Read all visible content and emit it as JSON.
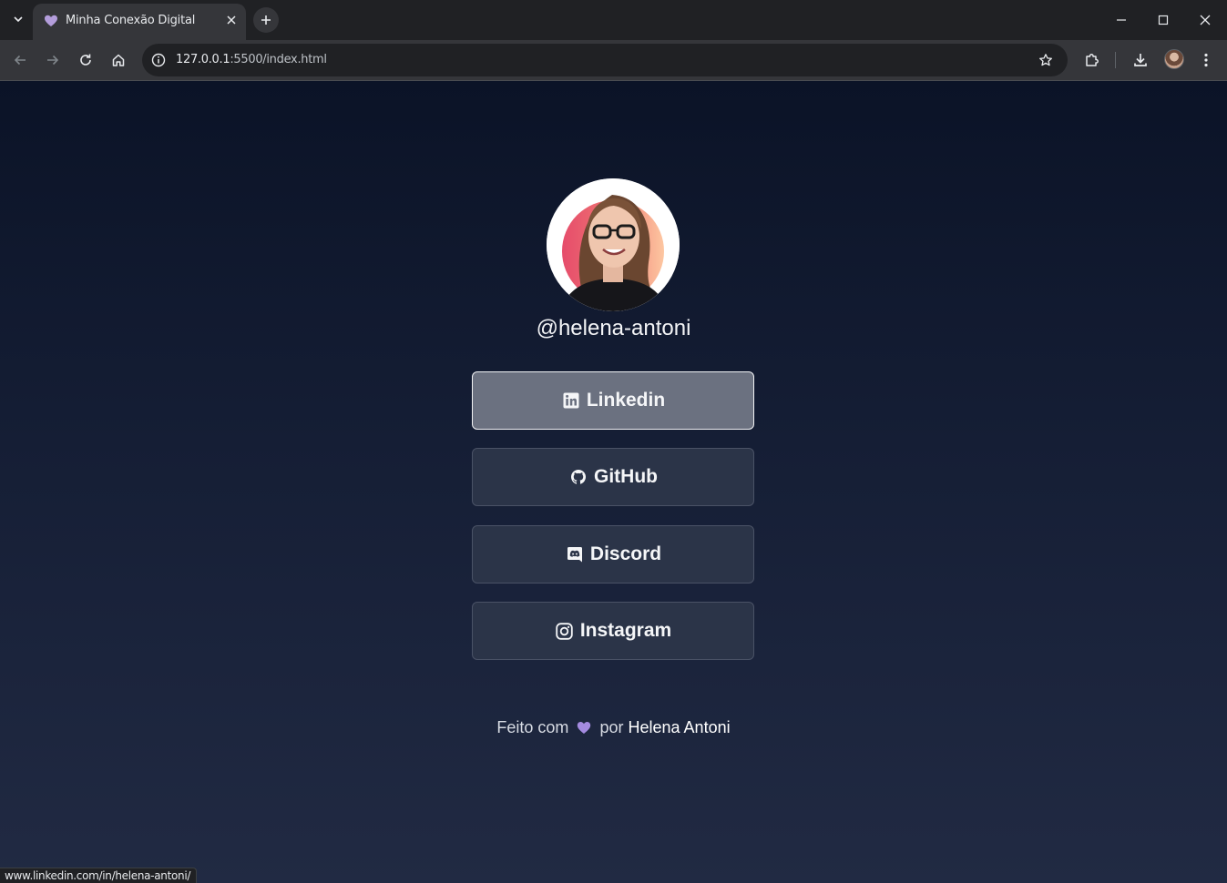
{
  "browser": {
    "tab_title": "Minha Conexão Digital",
    "url_host": "127.0.0.1",
    "url_rest": ":5500/index.html",
    "status_url": "www.linkedin.com/in/helena-antoni/"
  },
  "profile": {
    "handle": "@helena-antoni"
  },
  "links": [
    {
      "label": "Linkedin",
      "icon": "linkedin-icon"
    },
    {
      "label": "GitHub",
      "icon": "github-icon"
    },
    {
      "label": "Discord",
      "icon": "discord-icon"
    },
    {
      "label": "Instagram",
      "icon": "instagram-icon"
    }
  ],
  "footer": {
    "made_with": "Feito com",
    "by": "por",
    "author": "Helena Antoni"
  },
  "colors": {
    "heart": "#a48be0",
    "page_top": "#0b1327",
    "page_bottom": "#212a43",
    "button_bg": "#2b3448",
    "button_hover_bg": "#6b7180"
  }
}
